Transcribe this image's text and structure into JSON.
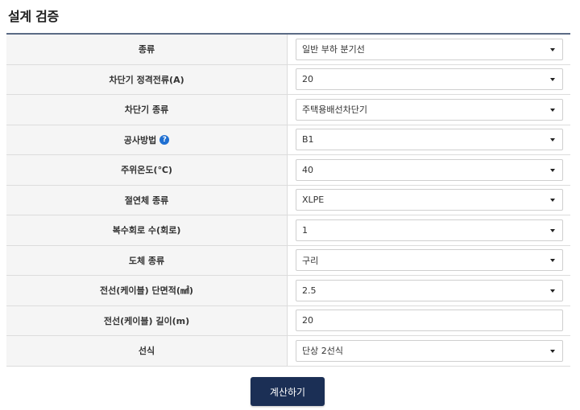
{
  "page": {
    "title": "설계 검증"
  },
  "form": {
    "rows": [
      {
        "label": "종류",
        "type": "select",
        "value": "일반 부하 분기선"
      },
      {
        "label": "차단기 정격전류(A)",
        "type": "select",
        "value": "20"
      },
      {
        "label": "차단기 종류",
        "type": "select",
        "value": "주택용배선차단기"
      },
      {
        "label": "공사방법",
        "type": "select",
        "value": "B1",
        "help_icon": "?"
      },
      {
        "label": "주위온도(℃)",
        "type": "select",
        "value": "40"
      },
      {
        "label": "절연체 종류",
        "type": "select",
        "value": "XLPE"
      },
      {
        "label": "복수회로 수(회로)",
        "type": "select",
        "value": "1"
      },
      {
        "label": "도체 종류",
        "type": "select",
        "value": "구리"
      },
      {
        "label": "전선(케이블) 단면적(㎟)",
        "type": "select",
        "value": "2.5"
      },
      {
        "label": "전선(케이블) 길이(m)",
        "type": "input",
        "value": "20"
      },
      {
        "label": "선식",
        "type": "select",
        "value": "단상 2선식"
      }
    ]
  },
  "actions": {
    "calculate_label": "계산하기"
  },
  "colors": {
    "button_bg": "#1b2f55",
    "header_border": "#5b6b85",
    "label_bg": "#f5f5f5",
    "help_icon": "#1f6fd1"
  }
}
